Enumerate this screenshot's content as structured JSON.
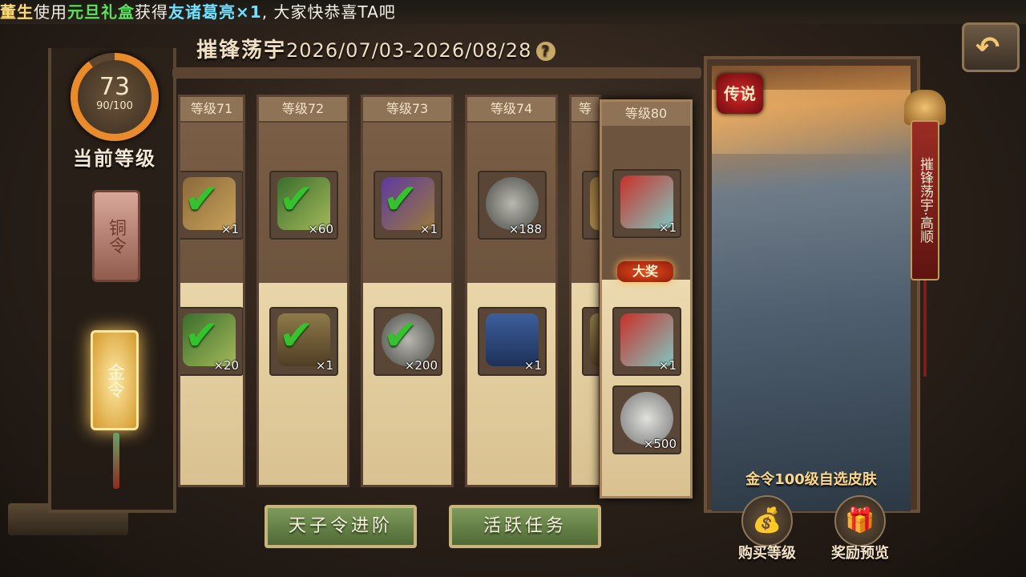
{
  "ticker": {
    "player": "董生",
    "used": "使用",
    "item": "元旦礼盒",
    "got": "获得",
    "reward": "友诸葛亮×1",
    "cheer": ", 大家快恭喜TA吧"
  },
  "header": {
    "title": "摧锋荡宇",
    "dates": "2026/07/03-2026/08/28",
    "help": "?"
  },
  "level": {
    "current": "73",
    "progress": "90/100",
    "progress_fraction": 0.9,
    "label": "当前等级"
  },
  "tabs": {
    "copper": "铜令",
    "gold": "金令"
  },
  "columns": [
    {
      "label": "等级71",
      "top_qty": "×1",
      "top_icon": "token",
      "top_claimed": true,
      "bot_qty": "×20",
      "bot_icon": "green",
      "bot_claimed": true
    },
    {
      "label": "等级72",
      "top_qty": "×60",
      "top_icon": "green",
      "top_claimed": true,
      "bot_qty": "×1",
      "bot_icon": "bag",
      "bot_claimed": true
    },
    {
      "label": "等级73",
      "top_qty": "×1",
      "top_icon": "purple",
      "top_claimed": true,
      "bot_qty": "×200",
      "bot_icon": "coin",
      "bot_claimed": true
    },
    {
      "label": "等级74",
      "top_qty": "×188",
      "top_icon": "coin",
      "top_claimed": false,
      "bot_qty": "×1",
      "bot_icon": "bluebag",
      "bot_claimed": false
    },
    {
      "label": "等",
      "top_qty": "",
      "top_icon": "token",
      "top_claimed": false,
      "bot_qty": "",
      "bot_icon": "bag",
      "bot_claimed": false
    }
  ],
  "grand_column": {
    "label": "等级80",
    "top_qty": "×1",
    "badge": "大奖",
    "bot_qty_1": "×1",
    "bot_qty_2": "×500"
  },
  "preview": {
    "rarity": "传说",
    "caption": "金令100级自选皮肤",
    "banner": "摧锋荡宇·高顺"
  },
  "buttons": {
    "advance": "天子令进阶",
    "tasks": "活跃任务",
    "buy_level": "购买等级",
    "reward_preview": "奖励预览"
  },
  "icons": {
    "back": "back-arrow-icon",
    "check": "checkmark-icon",
    "buy": "money-bag-icon",
    "gift": "gift-box-icon"
  },
  "colors": {
    "accent": "#e98b2a",
    "check": "#36c12e",
    "button": "#6b8a4a"
  }
}
